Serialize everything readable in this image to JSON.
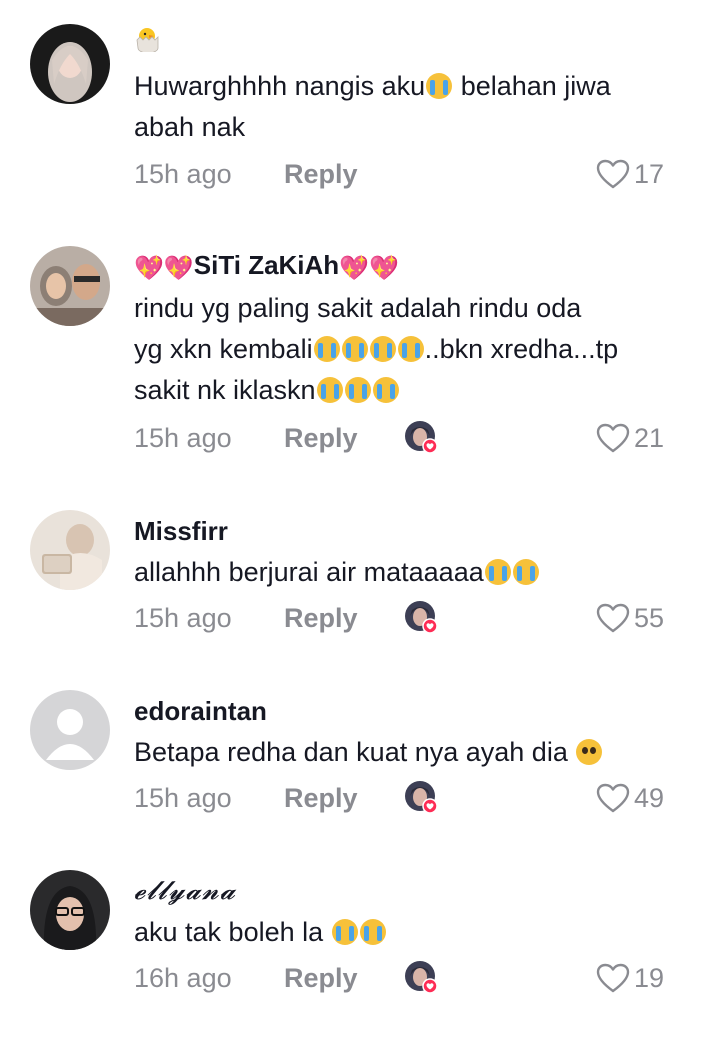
{
  "comments": [
    {
      "username": "",
      "username_emoji": "hatching-chick",
      "text_lines": [
        "Huwarghhhh nangis aku|cry| belahan jiwa",
        "abah nak"
      ],
      "time": "15h ago",
      "reply_label": "Reply",
      "creator_liked": false,
      "likes": "17"
    },
    {
      "username": "SiTi ZaKiAh",
      "username_prefix_emoji": "sparkling-heart x2",
      "username_suffix_emoji": "sparkling-heart x2",
      "text_lines": [
        "rindu yg paling sakit adalah rindu oda",
        "yg xkn kembali|cry4|..bkn xredha...tp",
        "sakit nk iklaskn|cry3|"
      ],
      "time": "15h ago",
      "reply_label": "Reply",
      "creator_liked": true,
      "likes": "21"
    },
    {
      "username": "Missfirr",
      "text_lines": [
        "allahhh berjurai air mataaaaa|cry2|"
      ],
      "time": "15h ago",
      "reply_label": "Reply",
      "creator_liked": true,
      "likes": "55"
    },
    {
      "username": "edoraintan",
      "text_lines": [
        "Betapa redha dan kuat nya ayah dia |sad|"
      ],
      "time": "15h ago",
      "reply_label": "Reply",
      "creator_liked": true,
      "likes": "49"
    },
    {
      "username": "𝓮𝓵𝓵𝔂𝓪𝓷𝓪",
      "text_lines": [
        "aku tak boleh la |cry2|"
      ],
      "time": "16h ago",
      "reply_label": "Reply",
      "creator_liked": true,
      "likes": "19"
    }
  ],
  "colors": {
    "text": "#161823",
    "secondary": "#8a8b91",
    "heart_badge": "#fe2c55",
    "emoji_heart": "#e6398f"
  },
  "icons": {
    "like": "heart-outline-icon",
    "creator_like_badge": "creator-liked-avatar-icon",
    "reply_emoji": "loudly-crying-face-icon"
  }
}
